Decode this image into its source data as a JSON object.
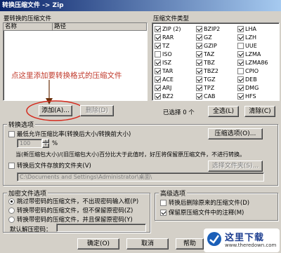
{
  "window": {
    "title": "转换压缩文件 -> Zip"
  },
  "left_list": {
    "label": "要转换的压缩文件",
    "columns": [
      "名称",
      "路径"
    ]
  },
  "annotation": {
    "text": "点这里添加要转换格式的压缩文件",
    "color": "#c0392b"
  },
  "buttons": {
    "add": "添加(A)...",
    "delete": "删除(D)",
    "select_all": "全选(L)",
    "clear": "清除(C)"
  },
  "file_types": {
    "label": "压缩文件类型",
    "selected_text": "已选择 0 个",
    "col1": [
      {
        "name": "ZIP (2)",
        "checked": true
      },
      {
        "name": "RAR",
        "checked": true
      },
      {
        "name": "TZ",
        "checked": true
      },
      {
        "name": "ISO",
        "checked": false
      },
      {
        "name": "ISZ",
        "checked": true
      },
      {
        "name": "TAR",
        "checked": true
      },
      {
        "name": "ACE",
        "checked": true
      },
      {
        "name": "ARJ",
        "checked": true
      },
      {
        "name": "BZ2",
        "checked": true
      }
    ],
    "col2": [
      {
        "name": "BZIP2",
        "checked": true
      },
      {
        "name": "GZ",
        "checked": true
      },
      {
        "name": "GZIP",
        "checked": true
      },
      {
        "name": "TAZ",
        "checked": true
      },
      {
        "name": "TBZ",
        "checked": true
      },
      {
        "name": "TBZ2",
        "checked": true
      },
      {
        "name": "TGZ",
        "checked": true
      },
      {
        "name": "TPZ",
        "checked": true
      },
      {
        "name": "CAB",
        "checked": true
      }
    ],
    "col3": [
      {
        "name": "LHA",
        "checked": true
      },
      {
        "name": "LZH",
        "checked": true
      },
      {
        "name": "UUE",
        "checked": false
      },
      {
        "name": "LZMA",
        "checked": true
      },
      {
        "name": "LZMA86",
        "checked": true
      },
      {
        "name": "CPIO",
        "checked": false
      },
      {
        "name": "DEB",
        "checked": true
      },
      {
        "name": "DMG",
        "checked": true
      },
      {
        "name": "HFS",
        "checked": true
      }
    ]
  },
  "convert_options": {
    "label": "转换选项",
    "min_ratio_label": "最低允许压缩比率(转换后大小/转换前大小)",
    "ratio_value": "100",
    "percent": "%",
    "compress_options_btn": "压缩选项(O)...",
    "ratio_desc": "当(新压缩包大小)/(旧压缩包大小)百分比大于此值时，好压将保留原压缩文件，不进行转换。",
    "folder_label": "转换后文件存放的文件夹(V)",
    "folder_path": "C:\\Documents and Settings\\Administrator\\桌面\\",
    "choose_folder_btn": "选择文件夹(S)..."
  },
  "encrypt": {
    "label": "加密文件选项",
    "opt1": "跳过带密码的压缩文件，不出现密码输入框(P)",
    "opt2": "转换带密码的压缩文件，但不保留原密码(Z)",
    "opt3": "转换带密码的压缩文件，并且保留原密码(Y)",
    "default_pw_label": "默认解压密码："
  },
  "advanced": {
    "label": "高级选项",
    "opt1": "转换后删除原来的压缩文件(D)",
    "opt2": "保留原压缩文件中的注释(M)"
  },
  "footer": {
    "ok": "确定(O)",
    "cancel": "取消",
    "help": "帮助"
  },
  "watermark": {
    "text": "这里下载",
    "url": "www.theredown.com"
  }
}
